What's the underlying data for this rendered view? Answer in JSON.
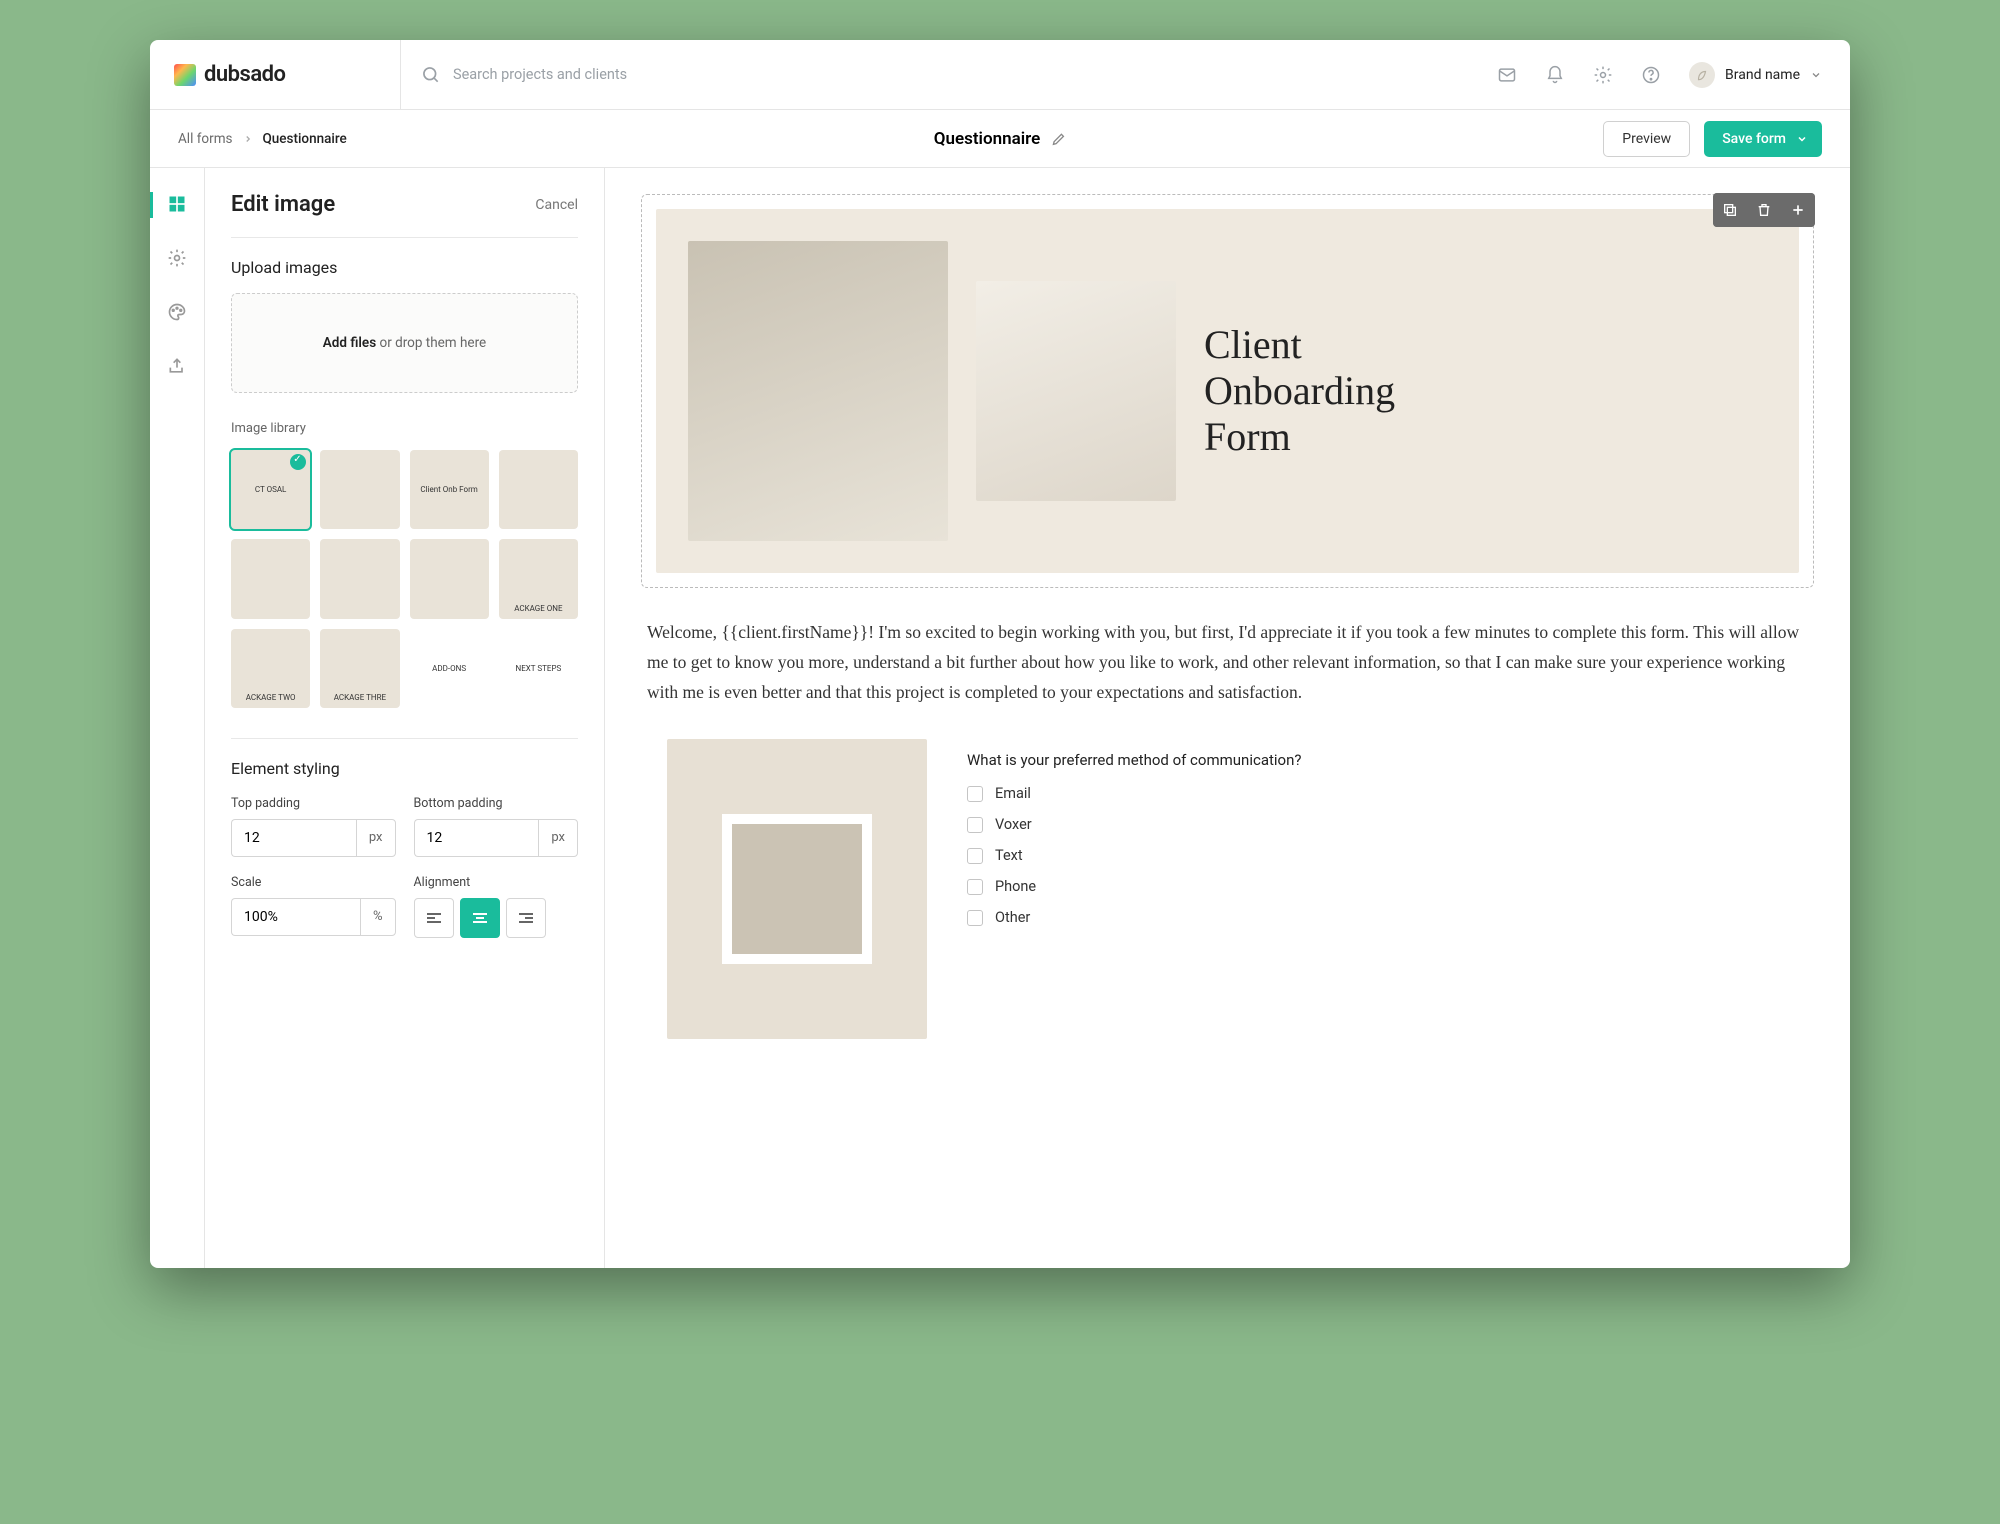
{
  "logo": "dubsado",
  "search": {
    "placeholder": "Search projects and clients"
  },
  "brand": {
    "name": "Brand name"
  },
  "breadcrumb": {
    "root": "All forms",
    "current": "Questionnaire"
  },
  "page_title": "Questionnaire",
  "buttons": {
    "preview": "Preview",
    "save": "Save form"
  },
  "panel": {
    "title": "Edit image",
    "cancel": "Cancel",
    "upload_heading": "Upload images",
    "upload_action": "Add files",
    "upload_hint": " or drop them here",
    "library_heading": "Image library",
    "thumbs": [
      "CT OSAL",
      "",
      "Client Onb Form",
      "",
      "",
      "",
      "",
      "",
      "ACKAGE TWO",
      "ACKAGE THRE",
      "ADD-ONS",
      "NEXT STEPS"
    ],
    "styling_heading": "Element styling",
    "top_padding_label": "Top padding",
    "bottom_padding_label": "Bottom padding",
    "scale_label": "Scale",
    "alignment_label": "Alignment",
    "top_padding": "12",
    "bottom_padding": "12",
    "scale": "100%",
    "unit_px": "px",
    "unit_pct": "%"
  },
  "hero": {
    "line1": "Client",
    "line2": "Onboarding",
    "line3": "Form"
  },
  "intro": "Welcome, {{client.firstName}}! I'm so excited to begin working with you, but first, I'd appreciate it if you took a few minutes to complete this form. This will allow me to get to know you more, understand a bit further about how you like to work, and other relevant information, so that I can make sure your experience working with me is even better and that this project is completed to your expectations and satisfaction.",
  "question": {
    "prompt": "What is your preferred method of communication?",
    "options": [
      "Email",
      "Voxer",
      "Text",
      "Phone",
      "Other"
    ]
  }
}
